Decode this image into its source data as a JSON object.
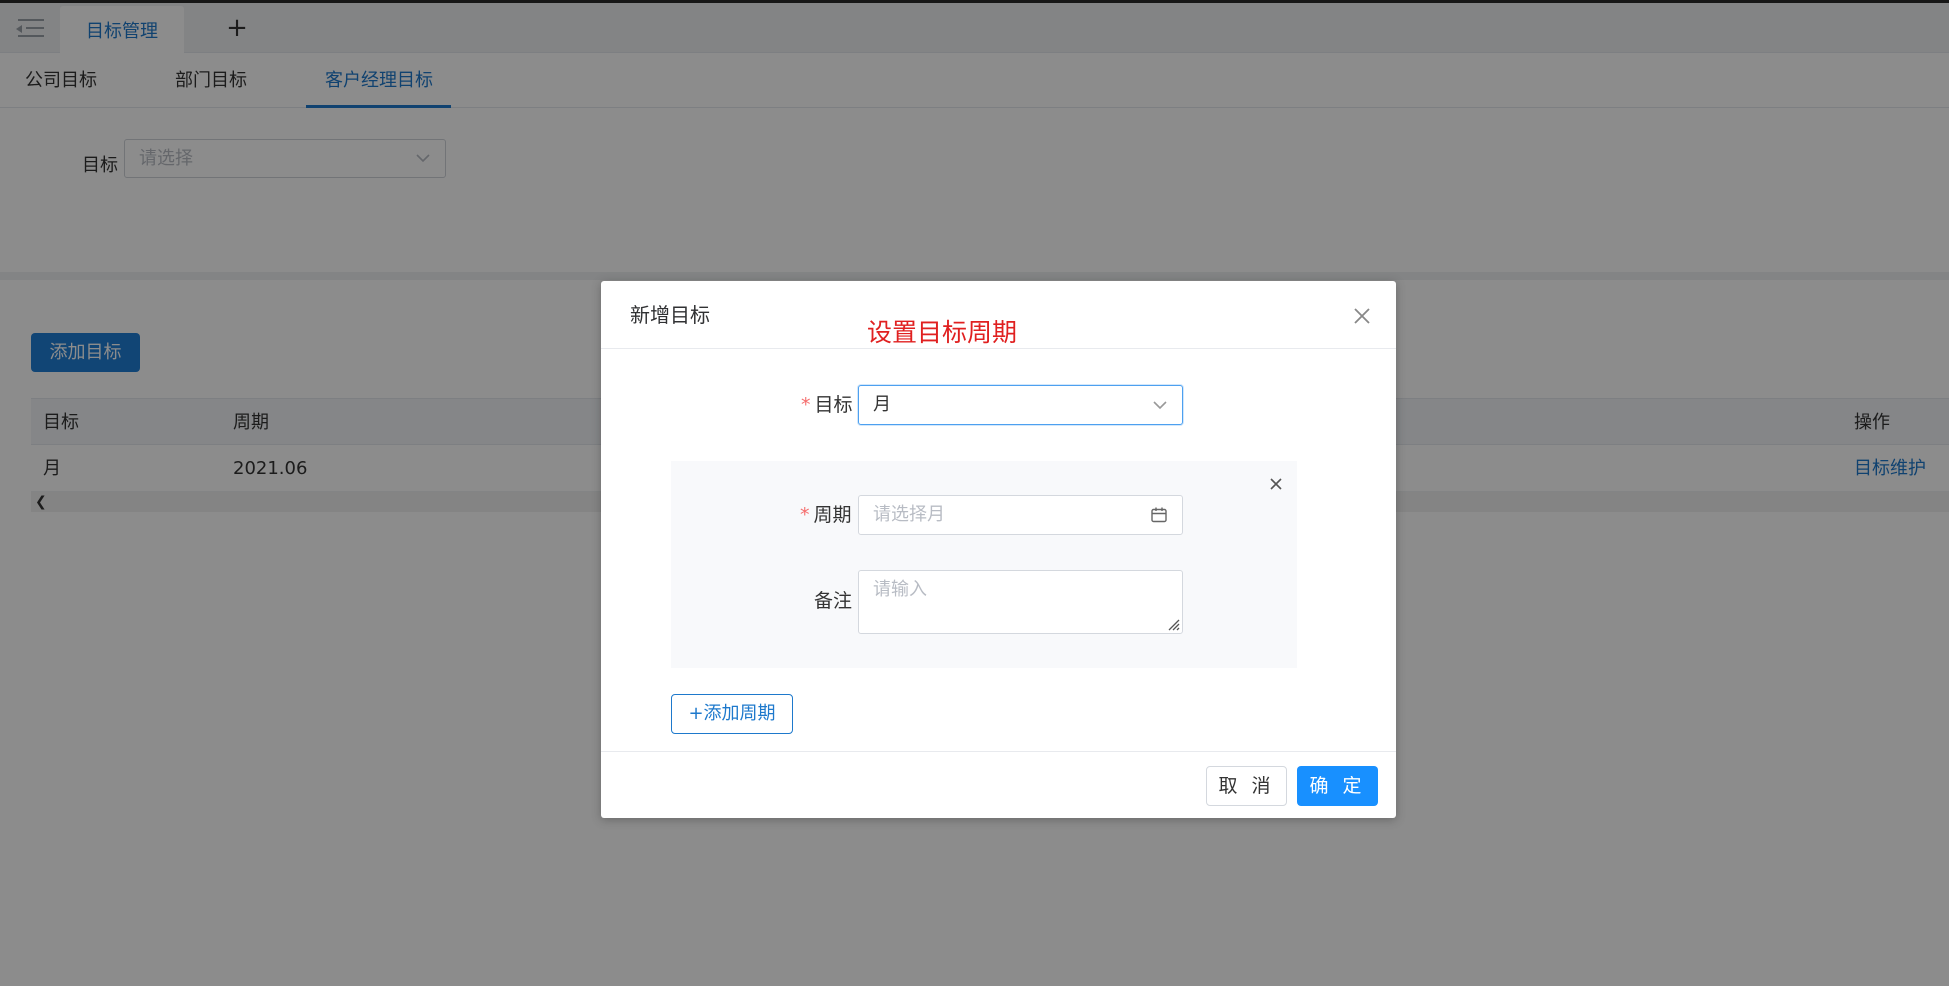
{
  "tabbar": {
    "active_tab": "目标管理",
    "add_icon": "plus-icon",
    "menu_icon": "menu-fold-icon"
  },
  "subtabs": [
    {
      "label": "公司目标",
      "active": false
    },
    {
      "label": "部门目标",
      "active": false
    },
    {
      "label": "客户经理目标",
      "active": true
    }
  ],
  "filter": {
    "label": "目标",
    "placeholder": "请选择"
  },
  "toolbar": {
    "add_button_label": "添加目标"
  },
  "table": {
    "columns": [
      "目标",
      "周期",
      "操作"
    ],
    "rows": [
      {
        "target": "月",
        "period": "2021.06",
        "action": "目标维护"
      }
    ],
    "scroll_left_icon": "chevron-left-icon"
  },
  "modal": {
    "title": "新增目标",
    "annotation": "设置目标周期",
    "target_label": "目标",
    "target_value": "月",
    "period_label": "周期",
    "period_placeholder": "请选择月",
    "remark_label": "备注",
    "remark_placeholder": "请输入",
    "add_period_label": "+添加周期",
    "cancel_label": "取 消",
    "confirm_label": "确 定"
  },
  "colors": {
    "accent": "#1e79cc",
    "primary_button": "#1890ff",
    "annotation_red": "#e02020",
    "required_star": "#f56c6c",
    "overlay": "rgba(0,0,0,0.45)"
  }
}
